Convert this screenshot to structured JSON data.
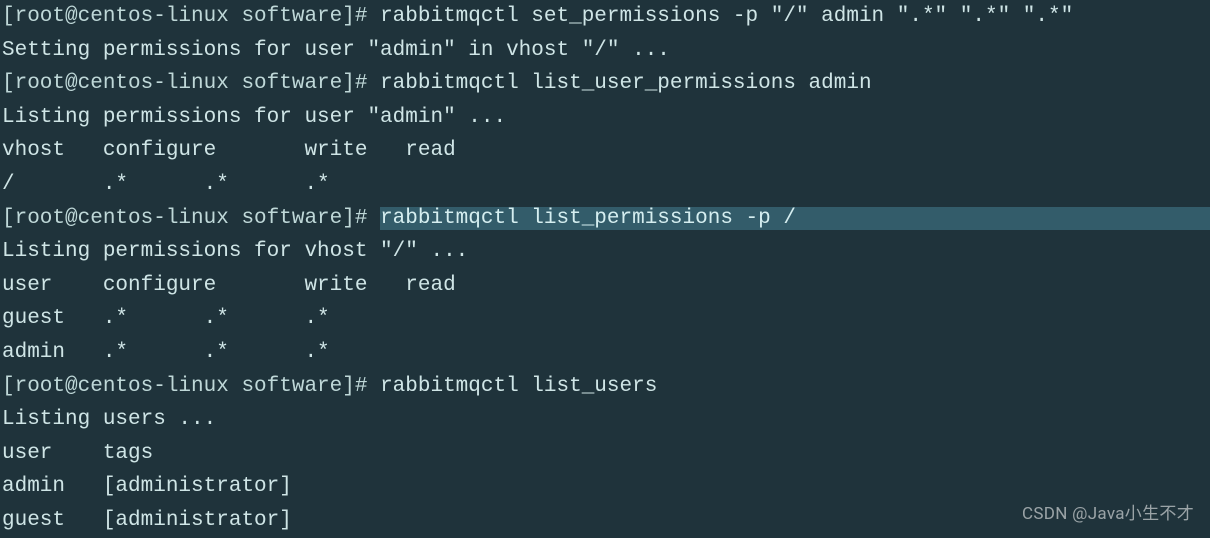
{
  "prompt": {
    "prefix": "[root@centos-linux software]# "
  },
  "lines": [
    {
      "type": "cmd",
      "text": "rabbitmqctl set_permissions -p \"/\" admin \".*\" \".*\" \".*\""
    },
    {
      "type": "out",
      "text": "Setting permissions for user \"admin\" in vhost \"/\" ..."
    },
    {
      "type": "cmd",
      "text": "rabbitmqctl list_user_permissions admin"
    },
    {
      "type": "out",
      "text": "Listing permissions for user \"admin\" ..."
    },
    {
      "type": "out",
      "text": "vhost   configure       write   read"
    },
    {
      "type": "out",
      "text": "/       .*      .*      .*"
    },
    {
      "type": "cmd",
      "hl": true,
      "text": "rabbitmqctl list_permissions -p /"
    },
    {
      "type": "out",
      "text": "Listing permissions for vhost \"/\" ..."
    },
    {
      "type": "out",
      "text": "user    configure       write   read"
    },
    {
      "type": "out",
      "text": "guest   .*      .*      .*"
    },
    {
      "type": "out",
      "text": "admin   .*      .*      .*"
    },
    {
      "type": "cmd",
      "text": "rabbitmqctl list_users"
    },
    {
      "type": "out",
      "text": "Listing users ..."
    },
    {
      "type": "out",
      "text": "user    tags"
    },
    {
      "type": "out",
      "text": "admin   [administrator]"
    },
    {
      "type": "out",
      "text": "guest   [administrator]"
    }
  ],
  "watermark": "CSDN @Java小生不才"
}
